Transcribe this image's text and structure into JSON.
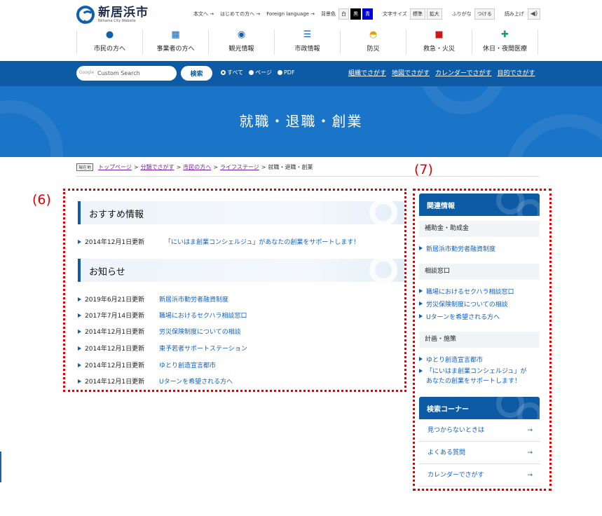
{
  "logo": {
    "title": "新居浜市",
    "subtitle": "Niihama City Website"
  },
  "util": {
    "links": [
      "本文へ →",
      "はじめての方へ →",
      "Foreign language →"
    ],
    "bg_label": "背景色",
    "bg_options": [
      "白",
      "黒",
      "青"
    ],
    "size_label": "文字サイズ",
    "size_options": [
      "標準",
      "拡大"
    ],
    "furigana_label": "ふりがな",
    "furigana_btn": "つける",
    "read_label": "読み上げ",
    "speaker_icon": "speaker-icon"
  },
  "gnav": [
    {
      "label": "市民の方へ",
      "icon": "person-icon",
      "glyph": "●"
    },
    {
      "label": "事業者の方へ",
      "icon": "building-icon",
      "glyph": "▦"
    },
    {
      "label": "観光情報",
      "icon": "pin-icon",
      "glyph": "◉"
    },
    {
      "label": "市政情報",
      "icon": "list-icon",
      "glyph": "☰"
    },
    {
      "label": "防災",
      "icon": "helmet-icon",
      "glyph": "◓"
    },
    {
      "label": "救急・火災",
      "icon": "firetruck-icon",
      "glyph": "■"
    },
    {
      "label": "休日・夜間医療",
      "icon": "medical-icon",
      "glyph": "✚"
    }
  ],
  "search": {
    "google_label": "Google",
    "value": "Custom Search",
    "button": "検索",
    "scopes": [
      {
        "label": "すべて",
        "selected": true
      },
      {
        "label": "ページ",
        "selected": false
      },
      {
        "label": "PDF",
        "selected": false
      }
    ],
    "links": [
      "組織でさがす",
      "地図でさがす",
      "カレンダーでさがす",
      "目的でさがす"
    ]
  },
  "banner_title": "就職・退職・創業",
  "breadcrumb": {
    "badge": "現在地",
    "items": [
      "トップページ",
      "分類でさがす",
      "市民の方へ",
      "ライフステージ"
    ],
    "current": "就職・退職・創業"
  },
  "annotations": {
    "main": "(6)",
    "side": "(7)"
  },
  "colors": {
    "accent": "#0d5ba5",
    "annotation": "#e00000",
    "link": "#1060c0"
  },
  "recommended": {
    "heading": "おすすめ情報",
    "items": [
      {
        "date": "2014年12月1日更新",
        "title": "「にいはま創業コンシェルジュ」があなたの創業をサポートします！"
      }
    ]
  },
  "notices": {
    "heading": "お知らせ",
    "items": [
      {
        "date": "2019年6月21日更新",
        "title": "新居浜市勤労者融資制度"
      },
      {
        "date": "2017年7月14日更新",
        "title": "職場におけるセクハラ相談窓口"
      },
      {
        "date": "2014年12月1日更新",
        "title": "労災保険制度についての相談"
      },
      {
        "date": "2014年12月1日更新",
        "title": "東予若者サポートステーション"
      },
      {
        "date": "2014年12月1日更新",
        "title": "ゆとり創造宣言都市"
      },
      {
        "date": "2014年12月1日更新",
        "title": "Uターンを希望される方へ"
      }
    ]
  },
  "sidebar": {
    "related_heading": "関連情報",
    "groups": [
      {
        "title": "補助金・助成金",
        "links": [
          "新居浜市勤労者融資制度"
        ]
      },
      {
        "title": "相談窓口",
        "links": [
          "職場におけるセクハラ相談窓口",
          "労災保険制度についての相談",
          "Uターンを希望される方へ"
        ]
      },
      {
        "title": "計画・施策",
        "links": [
          "ゆとり創造宣言都市",
          "「にいはま創業コンシェルジュ」があなたの創業をサポートします！"
        ]
      }
    ],
    "search_heading": "検索コーナー",
    "search_links": [
      "見つからないときは",
      "よくある質問",
      "カレンダーでさがす"
    ],
    "arrow": "→"
  }
}
